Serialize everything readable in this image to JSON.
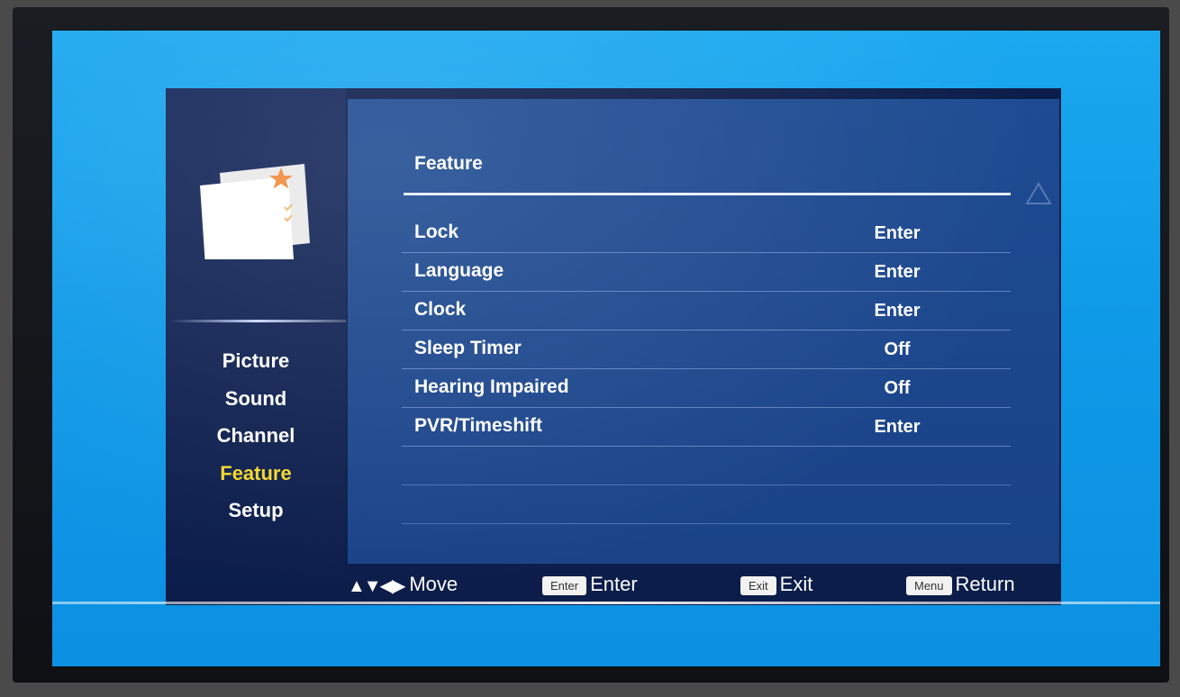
{
  "menu": {
    "title": "Feature",
    "nav": [
      {
        "label": "Picture",
        "active": false
      },
      {
        "label": "Sound",
        "active": false
      },
      {
        "label": "Channel",
        "active": false
      },
      {
        "label": "Feature",
        "active": true
      },
      {
        "label": "Setup",
        "active": false
      }
    ],
    "rows": [
      {
        "label": "Lock",
        "value": "Enter"
      },
      {
        "label": "Language",
        "value": "Enter"
      },
      {
        "label": "Clock",
        "value": "Enter"
      },
      {
        "label": "Sleep Timer",
        "value": "Off"
      },
      {
        "label": "Hearing Impaired",
        "value": "Off"
      },
      {
        "label": "PVR/Timeshift",
        "value": "Enter"
      }
    ],
    "empty_rows": 2
  },
  "hints": {
    "move_label": "Move",
    "enter_key": "Enter",
    "enter_label": "Enter",
    "exit_key": "Exit",
    "exit_label": "Exit",
    "menu_key": "Menu",
    "menu_label": "Return"
  },
  "icons": {
    "feature": "feature-card-star-icon",
    "arrows": "arrow-keys-icon"
  },
  "colors": {
    "screen_background": "#1ba8ef",
    "menu_panel": "#0c1d4a",
    "content_panel": "#1e4b92",
    "active_nav": "#f5d62a",
    "star": "#f08a3c"
  }
}
